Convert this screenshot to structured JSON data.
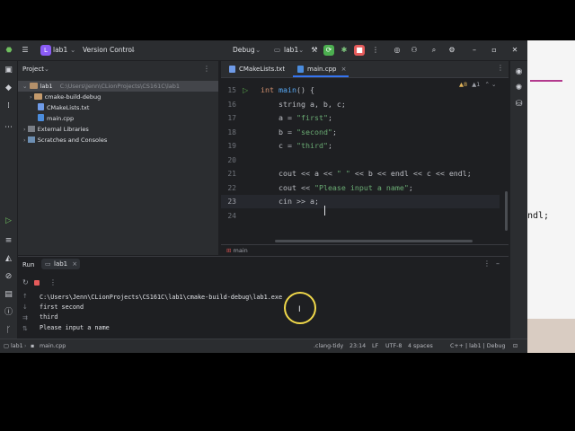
{
  "titlebar": {
    "project_badge": "L",
    "project_name": "lab1",
    "vcs_label": "Version Control",
    "config_label": "Debug",
    "target_label": "lab1"
  },
  "project_panel": {
    "title": "Project",
    "tree": [
      {
        "label": "lab1",
        "path": "C:\\Users\\Jenn\\CLionProjects\\CS161C\\lab1"
      },
      {
        "label": "cmake-build-debug"
      },
      {
        "label": "CMakeLists.txt"
      },
      {
        "label": "main.cpp"
      },
      {
        "label": "External Libraries"
      },
      {
        "label": "Scratches and Consoles"
      }
    ]
  },
  "editor": {
    "tabs": [
      {
        "label": "CMakeLists.txt"
      },
      {
        "label": "main.cpp"
      }
    ],
    "inspection": {
      "warnings": "8",
      "weak": "1"
    },
    "breadcrumb": "main",
    "lines": [
      {
        "num": "15",
        "parts": [
          {
            "t": "int ",
            "c": "kw"
          },
          {
            "t": "main",
            "c": "fn"
          },
          {
            "t": "() {",
            "c": "id"
          }
        ]
      },
      {
        "num": "16",
        "parts": [
          {
            "t": "    string a, b, c;",
            "c": "id"
          }
        ]
      },
      {
        "num": "17",
        "parts": [
          {
            "t": "    a = ",
            "c": "id"
          },
          {
            "t": "\"first\"",
            "c": "str"
          },
          {
            "t": ";",
            "c": "id"
          }
        ]
      },
      {
        "num": "18",
        "parts": [
          {
            "t": "    b = ",
            "c": "id"
          },
          {
            "t": "\"second\"",
            "c": "str"
          },
          {
            "t": ";",
            "c": "id"
          }
        ]
      },
      {
        "num": "19",
        "parts": [
          {
            "t": "    c = ",
            "c": "id"
          },
          {
            "t": "\"third\"",
            "c": "str"
          },
          {
            "t": ";",
            "c": "id"
          }
        ]
      },
      {
        "num": "20",
        "parts": []
      },
      {
        "num": "21",
        "parts": [
          {
            "t": "    cout << a << ",
            "c": "id"
          },
          {
            "t": "\" \"",
            "c": "str"
          },
          {
            "t": " << b << endl << c << endl;",
            "c": "id"
          }
        ]
      },
      {
        "num": "22",
        "parts": [
          {
            "t": "    cout << ",
            "c": "id"
          },
          {
            "t": "\"Please input a name\"",
            "c": "str"
          },
          {
            "t": ";",
            "c": "id"
          }
        ]
      },
      {
        "num": "23",
        "parts": [
          {
            "t": "    cin >> a;",
            "c": "id"
          }
        ]
      },
      {
        "num": "24",
        "parts": []
      }
    ]
  },
  "run_panel": {
    "title": "Run",
    "tab_label": "lab1",
    "output": [
      "C:\\Users\\Jenn\\CLionProjects\\CS161C\\lab1\\cmake-build-debug\\lab1.exe",
      "first second",
      "third",
      "Please input a name"
    ]
  },
  "statusbar": {
    "crumb_project": "lab1",
    "crumb_file": "main.cpp",
    "items": [
      ".clang-tidy",
      "23:14",
      "LF",
      "UTF-8",
      "4 spaces",
      "C++ | lab1 | Debug"
    ]
  },
  "background_fragment": "ndl;",
  "colors": {
    "accent": "#3574f0",
    "run_green": "#4caf50",
    "stop_red": "#e55b5b",
    "ide_bg": "#1e1f22",
    "panel_bg": "#2b2d30"
  }
}
